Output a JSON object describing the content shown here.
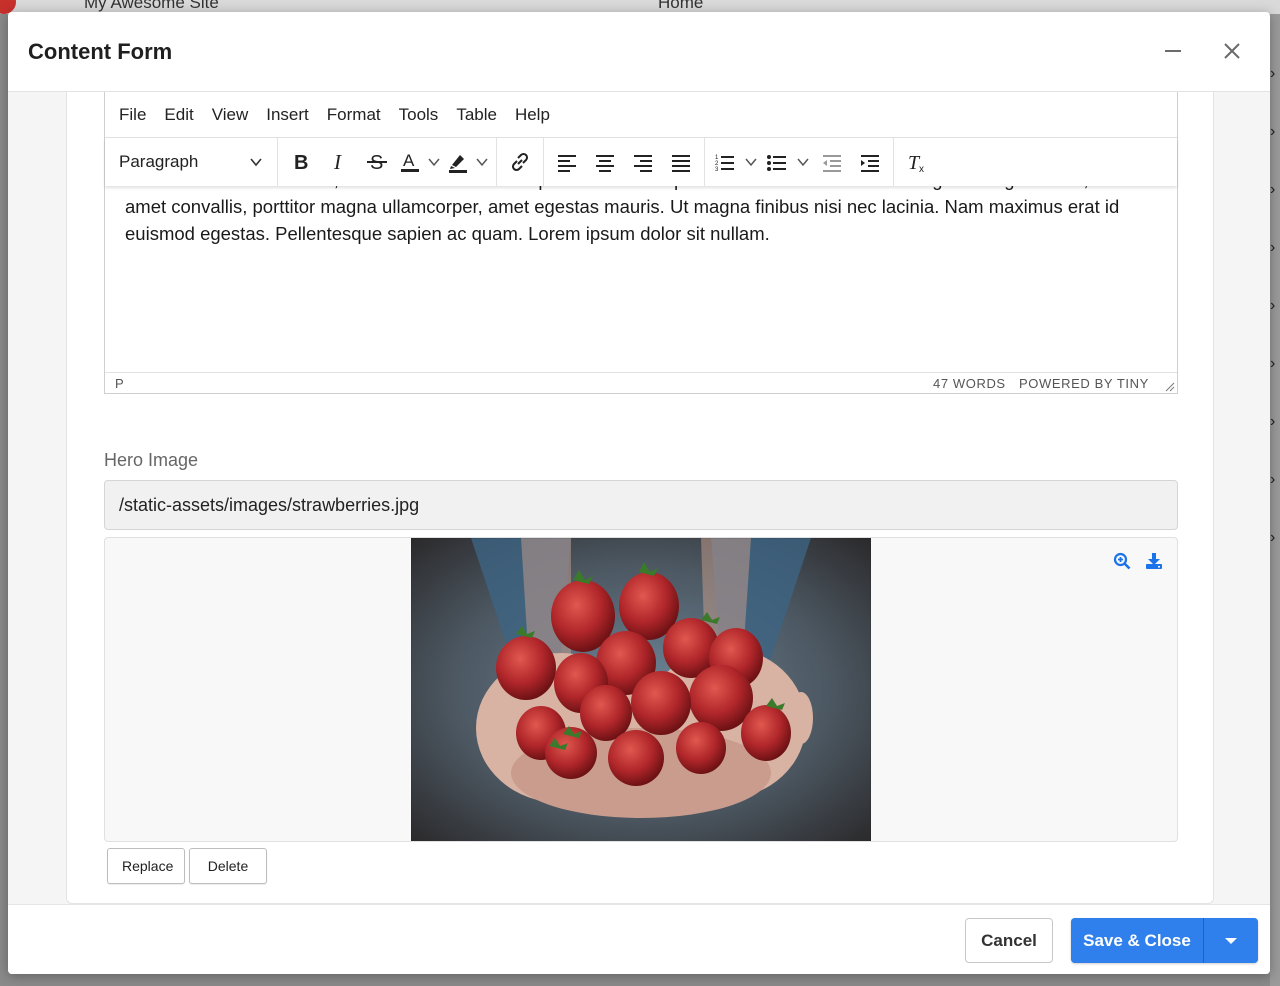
{
  "background": {
    "site_name": "My Awesome Site",
    "tab_title": "Home"
  },
  "modal": {
    "title": "Content Form"
  },
  "editor": {
    "menu": [
      "File",
      "Edit",
      "View",
      "Insert",
      "Format",
      "Tools",
      "Table",
      "Help"
    ],
    "block_format": "Paragraph",
    "toolbar_icons": [
      "bold-icon",
      "italic-icon",
      "strikethrough-icon",
      "text-color-icon",
      "highlight-icon",
      "link-icon",
      "align-left-icon",
      "align-center-icon",
      "align-right-icon",
      "align-justify-icon",
      "numbered-list-icon",
      "bullet-list-icon",
      "outdent-icon",
      "indent-icon",
      "clear-formatting-icon"
    ],
    "content": "Aenean ornare velit lacus, ac varius enim ullamcorper eu. Proin aliquam facilisis ante interdum congue. Integer mollis, nisl amet convallis, porttitor magna ullamcorper, amet egestas mauris. Ut magna finibus nisi nec lacinia. Nam maximus erat id euismod egestas. Pellentesque sapien ac quam. Lorem ipsum dolor sit nullam.",
    "status_path": "P",
    "word_count": "47 WORDS",
    "branding": "POWERED BY TINY"
  },
  "hero_image": {
    "label": "Hero Image",
    "path": "/static-assets/images/strawberries.jpg",
    "replace_label": "Replace",
    "delete_label": "Delete",
    "preview_icons": [
      "zoom-in-icon",
      "download-icon"
    ]
  },
  "footer": {
    "cancel_label": "Cancel",
    "save_label": "Save & Close"
  },
  "colors": {
    "primary": "#2f80ed",
    "icon_blue": "#1a73e8"
  }
}
